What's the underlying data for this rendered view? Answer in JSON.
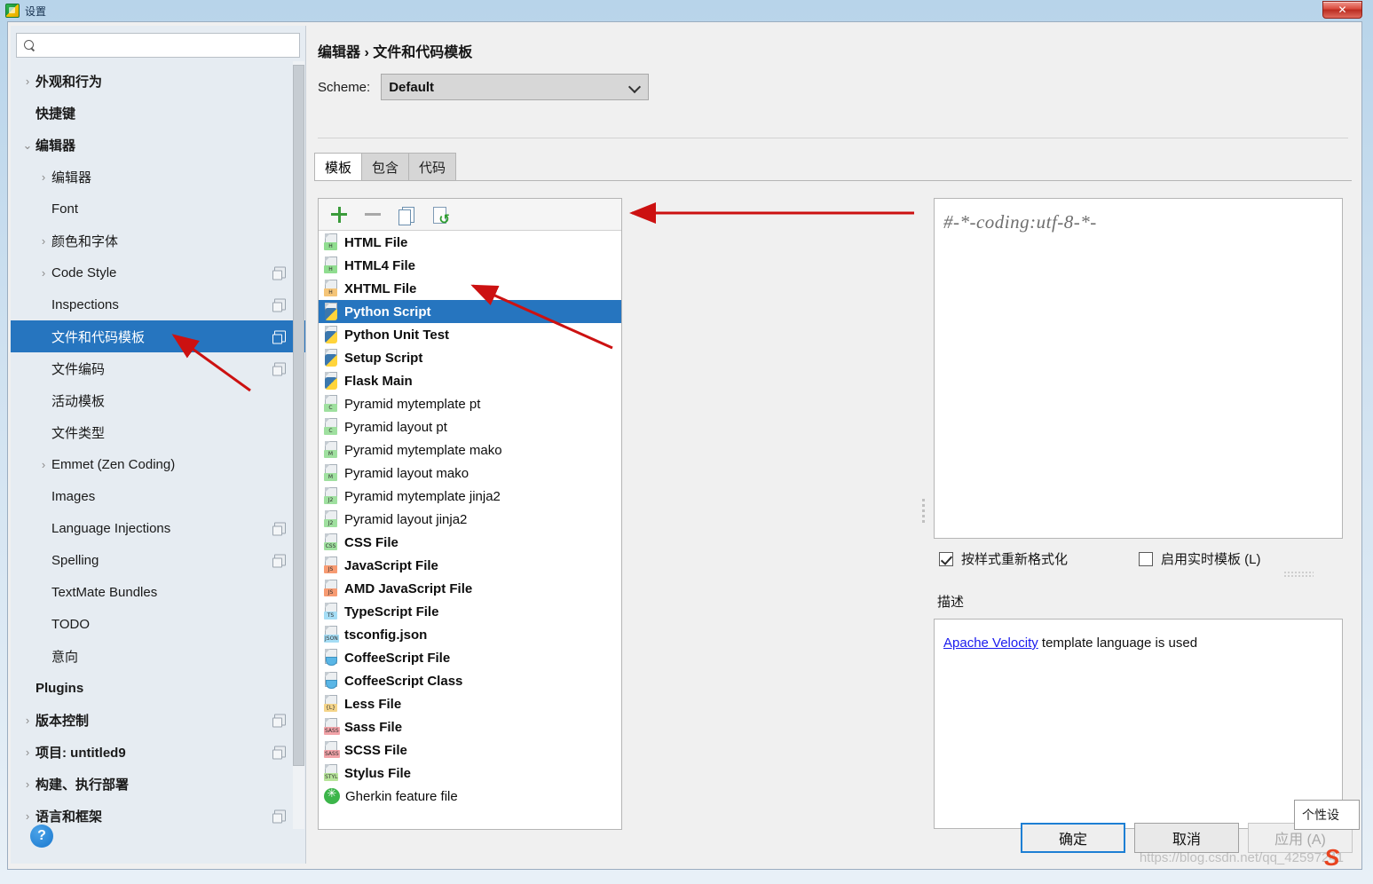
{
  "window": {
    "title": "设置",
    "icon": "pycharm-icon",
    "close_label": "✕"
  },
  "sidebar": {
    "search": {
      "value": "",
      "placeholder": "",
      "icon": "search-icon"
    },
    "items": [
      {
        "label": "外观和行为",
        "arrow": "collapsed",
        "indent": 0,
        "bold": true,
        "badge": false,
        "selected": false
      },
      {
        "label": "快捷键",
        "arrow": "none",
        "indent": 0,
        "bold": true,
        "badge": false,
        "selected": false
      },
      {
        "label": "编辑器",
        "arrow": "expanded",
        "indent": 0,
        "bold": true,
        "badge": false,
        "selected": false
      },
      {
        "label": "编辑器",
        "arrow": "collapsed",
        "indent": 1,
        "bold": false,
        "badge": false,
        "selected": false
      },
      {
        "label": "Font",
        "arrow": "none",
        "indent": 1,
        "bold": false,
        "badge": false,
        "selected": false
      },
      {
        "label": "颜色和字体",
        "arrow": "collapsed",
        "indent": 1,
        "bold": false,
        "badge": false,
        "selected": false
      },
      {
        "label": "Code Style",
        "arrow": "collapsed",
        "indent": 1,
        "bold": false,
        "badge": true,
        "selected": false
      },
      {
        "label": "Inspections",
        "arrow": "none",
        "indent": 1,
        "bold": false,
        "badge": true,
        "selected": false
      },
      {
        "label": "文件和代码模板",
        "arrow": "none",
        "indent": 1,
        "bold": false,
        "badge": true,
        "selected": true
      },
      {
        "label": "文件编码",
        "arrow": "none",
        "indent": 1,
        "bold": false,
        "badge": true,
        "selected": false
      },
      {
        "label": "活动模板",
        "arrow": "none",
        "indent": 1,
        "bold": false,
        "badge": false,
        "selected": false
      },
      {
        "label": "文件类型",
        "arrow": "none",
        "indent": 1,
        "bold": false,
        "badge": false,
        "selected": false
      },
      {
        "label": "Emmet (Zen Coding)",
        "arrow": "collapsed",
        "indent": 1,
        "bold": false,
        "badge": false,
        "selected": false
      },
      {
        "label": "Images",
        "arrow": "none",
        "indent": 1,
        "bold": false,
        "badge": false,
        "selected": false
      },
      {
        "label": "Language Injections",
        "arrow": "none",
        "indent": 1,
        "bold": false,
        "badge": true,
        "selected": false
      },
      {
        "label": "Spelling",
        "arrow": "none",
        "indent": 1,
        "bold": false,
        "badge": true,
        "selected": false
      },
      {
        "label": "TextMate Bundles",
        "arrow": "none",
        "indent": 1,
        "bold": false,
        "badge": false,
        "selected": false
      },
      {
        "label": "TODO",
        "arrow": "none",
        "indent": 1,
        "bold": false,
        "badge": false,
        "selected": false
      },
      {
        "label": "意向",
        "arrow": "none",
        "indent": 1,
        "bold": false,
        "badge": false,
        "selected": false
      },
      {
        "label": "Plugins",
        "arrow": "none",
        "indent": 0,
        "bold": true,
        "badge": false,
        "selected": false
      },
      {
        "label": "版本控制",
        "arrow": "collapsed",
        "indent": 0,
        "bold": true,
        "badge": true,
        "selected": false
      },
      {
        "label": "项目: untitled9",
        "arrow": "collapsed",
        "indent": 0,
        "bold": true,
        "badge": true,
        "selected": false
      },
      {
        "label": "构建、执行部署",
        "arrow": "collapsed",
        "indent": 0,
        "bold": true,
        "badge": false,
        "selected": false
      },
      {
        "label": "语言和框架",
        "arrow": "collapsed",
        "indent": 0,
        "bold": true,
        "badge": true,
        "selected": false
      }
    ],
    "help_label": "?"
  },
  "main": {
    "breadcrumb": "编辑器 › 文件和代码模板",
    "scheme_label": "Scheme:",
    "scheme_value": "Default",
    "tabs": [
      {
        "label": "模板",
        "active": true
      },
      {
        "label": "包含",
        "active": false
      },
      {
        "label": "代码",
        "active": false
      }
    ],
    "toolbar": {
      "add_icon": "plus-icon",
      "remove_icon": "minus-icon",
      "copy_icon": "copy-icon",
      "reset_icon": "reset-icon"
    },
    "templates": [
      {
        "label": "HTML File",
        "icon": "html-file-icon",
        "tag": "H",
        "tagcolor": "#90dd90",
        "bold": true,
        "selected": false
      },
      {
        "label": "HTML4 File",
        "icon": "html-file-icon",
        "tag": "H",
        "tagcolor": "#90dd90",
        "bold": true,
        "selected": false
      },
      {
        "label": "XHTML File",
        "icon": "xhtml-file-icon",
        "tag": "H",
        "tagcolor": "#f5c578",
        "bold": true,
        "selected": false
      },
      {
        "label": "Python Script",
        "icon": "python-file-icon",
        "tag": "PY",
        "tagcolor": "",
        "bold": true,
        "selected": true
      },
      {
        "label": "Python Unit Test",
        "icon": "python-file-icon",
        "tag": "PY",
        "tagcolor": "",
        "bold": true,
        "selected": false
      },
      {
        "label": "Setup Script",
        "icon": "python-file-icon",
        "tag": "PY",
        "tagcolor": "",
        "bold": true,
        "selected": false
      },
      {
        "label": "Flask Main",
        "icon": "python-file-icon",
        "tag": "PY",
        "tagcolor": "",
        "bold": true,
        "selected": false
      },
      {
        "label": "Pyramid mytemplate pt",
        "icon": "chameleon-file-icon",
        "tag": "C",
        "tagcolor": "#9fe09f",
        "bold": false,
        "selected": false
      },
      {
        "label": "Pyramid layout pt",
        "icon": "chameleon-file-icon",
        "tag": "C",
        "tagcolor": "#9fe09f",
        "bold": false,
        "selected": false
      },
      {
        "label": "Pyramid mytemplate mako",
        "icon": "mako-file-icon",
        "tag": "M",
        "tagcolor": "#9fe09f",
        "bold": false,
        "selected": false
      },
      {
        "label": "Pyramid layout mako",
        "icon": "mako-file-icon",
        "tag": "M",
        "tagcolor": "#9fe09f",
        "bold": false,
        "selected": false
      },
      {
        "label": "Pyramid mytemplate jinja2",
        "icon": "jinja2-file-icon",
        "tag": "J2",
        "tagcolor": "#9fe09f",
        "bold": false,
        "selected": false
      },
      {
        "label": "Pyramid layout jinja2",
        "icon": "jinja2-file-icon",
        "tag": "J2",
        "tagcolor": "#9fe09f",
        "bold": false,
        "selected": false
      },
      {
        "label": "CSS File",
        "icon": "css-file-icon",
        "tag": "CSS",
        "tagcolor": "#9fe09f",
        "bold": true,
        "selected": false
      },
      {
        "label": "JavaScript File",
        "icon": "js-file-icon",
        "tag": "JS",
        "tagcolor": "#f79b72",
        "bold": true,
        "selected": false
      },
      {
        "label": "AMD JavaScript File",
        "icon": "js-file-icon",
        "tag": "JS",
        "tagcolor": "#f79b72",
        "bold": true,
        "selected": false
      },
      {
        "label": "TypeScript File",
        "icon": "ts-file-icon",
        "tag": "TS",
        "tagcolor": "#a5ddf5",
        "bold": true,
        "selected": false
      },
      {
        "label": "tsconfig.json",
        "icon": "json-file-icon",
        "tag": "JSON",
        "tagcolor": "#a5ddf5",
        "bold": true,
        "selected": false
      },
      {
        "label": "CoffeeScript File",
        "icon": "coffee-file-icon",
        "tag": "",
        "tagcolor": "",
        "bold": true,
        "selected": false
      },
      {
        "label": "CoffeeScript Class",
        "icon": "coffee-file-icon",
        "tag": "",
        "tagcolor": "",
        "bold": true,
        "selected": false
      },
      {
        "label": "Less File",
        "icon": "less-file-icon",
        "tag": "{L}",
        "tagcolor": "#f5d58a",
        "bold": true,
        "selected": false
      },
      {
        "label": "Sass File",
        "icon": "sass-file-icon",
        "tag": "SASS",
        "tagcolor": "#f2a3a8",
        "bold": true,
        "selected": false
      },
      {
        "label": "SCSS File",
        "icon": "sass-file-icon",
        "tag": "SASS",
        "tagcolor": "#f2a3a8",
        "bold": true,
        "selected": false
      },
      {
        "label": "Stylus File",
        "icon": "stylus-file-icon",
        "tag": "STYL",
        "tagcolor": "#b7e59a",
        "bold": true,
        "selected": false
      },
      {
        "label": "Gherkin feature file",
        "icon": "gherkin-icon",
        "tag": "",
        "tagcolor": "",
        "bold": false,
        "selected": false
      }
    ],
    "editor": {
      "content": "#-*-coding:utf-8-*-"
    },
    "reformat_checkbox": {
      "label": "按样式重新格式化",
      "checked": true
    },
    "live_template_checkbox": {
      "label": "启用实时模板 (L)",
      "checked": false
    },
    "description_legend": "描述",
    "description_link": "Apache Velocity",
    "description_text": " template language is used"
  },
  "footer": {
    "ok_label": "确定",
    "cancel_label": "取消",
    "apply_label": "应用 (A)",
    "tooltip": "个性设",
    "watermark": "https://blog.csdn.net/qq_42597241"
  }
}
